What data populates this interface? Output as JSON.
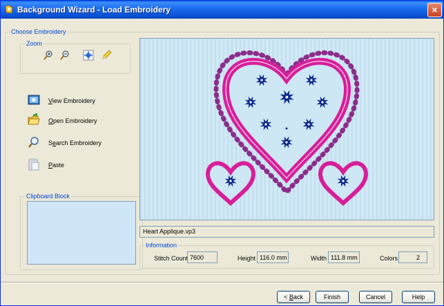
{
  "window": {
    "title": "Background Wizard - Load Embroidery",
    "close_label": "×"
  },
  "choose_group": {
    "title": "Choose Embroidery"
  },
  "zoom_group": {
    "title": "Zoom"
  },
  "zoom_tools": [
    {
      "name": "zoom-in-icon"
    },
    {
      "name": "zoom-out-icon"
    },
    {
      "name": "zoom-fit-icon"
    },
    {
      "name": "pencil-icon"
    }
  ],
  "actions": [
    {
      "prefix": "",
      "underline": "V",
      "rest": "iew Embroidery",
      "icon": "view-icon"
    },
    {
      "prefix": "",
      "underline": "O",
      "rest": "pen Embroidery",
      "icon": "open-folder-icon"
    },
    {
      "prefix": "S",
      "underline": "e",
      "rest": "arch Embroidery",
      "icon": "search-icon"
    },
    {
      "prefix": "",
      "underline": "P",
      "rest": "aste",
      "icon": "paste-icon"
    }
  ],
  "clipboard_group": {
    "title": "Clipboard Block"
  },
  "filename": "Heart Applique.vp3",
  "info_group": {
    "title": "Information"
  },
  "info": {
    "stitch_label": "Stitch Count",
    "stitch_value": "7600",
    "height_label": "Height",
    "height_value": "116.0 mm",
    "width_label": "Width",
    "width_value": "111.8 mm",
    "colors_label": "Colors",
    "colors_value": "2"
  },
  "buttons": {
    "back_prefix": "< ",
    "back_underline": "B",
    "back_rest": "ack",
    "finish": "Finish",
    "cancel": "Cancel",
    "help": "Help"
  },
  "colors": {
    "heart": "#d81f9a",
    "flower": "#0e2a8c",
    "fabric": "#cde7f4"
  }
}
